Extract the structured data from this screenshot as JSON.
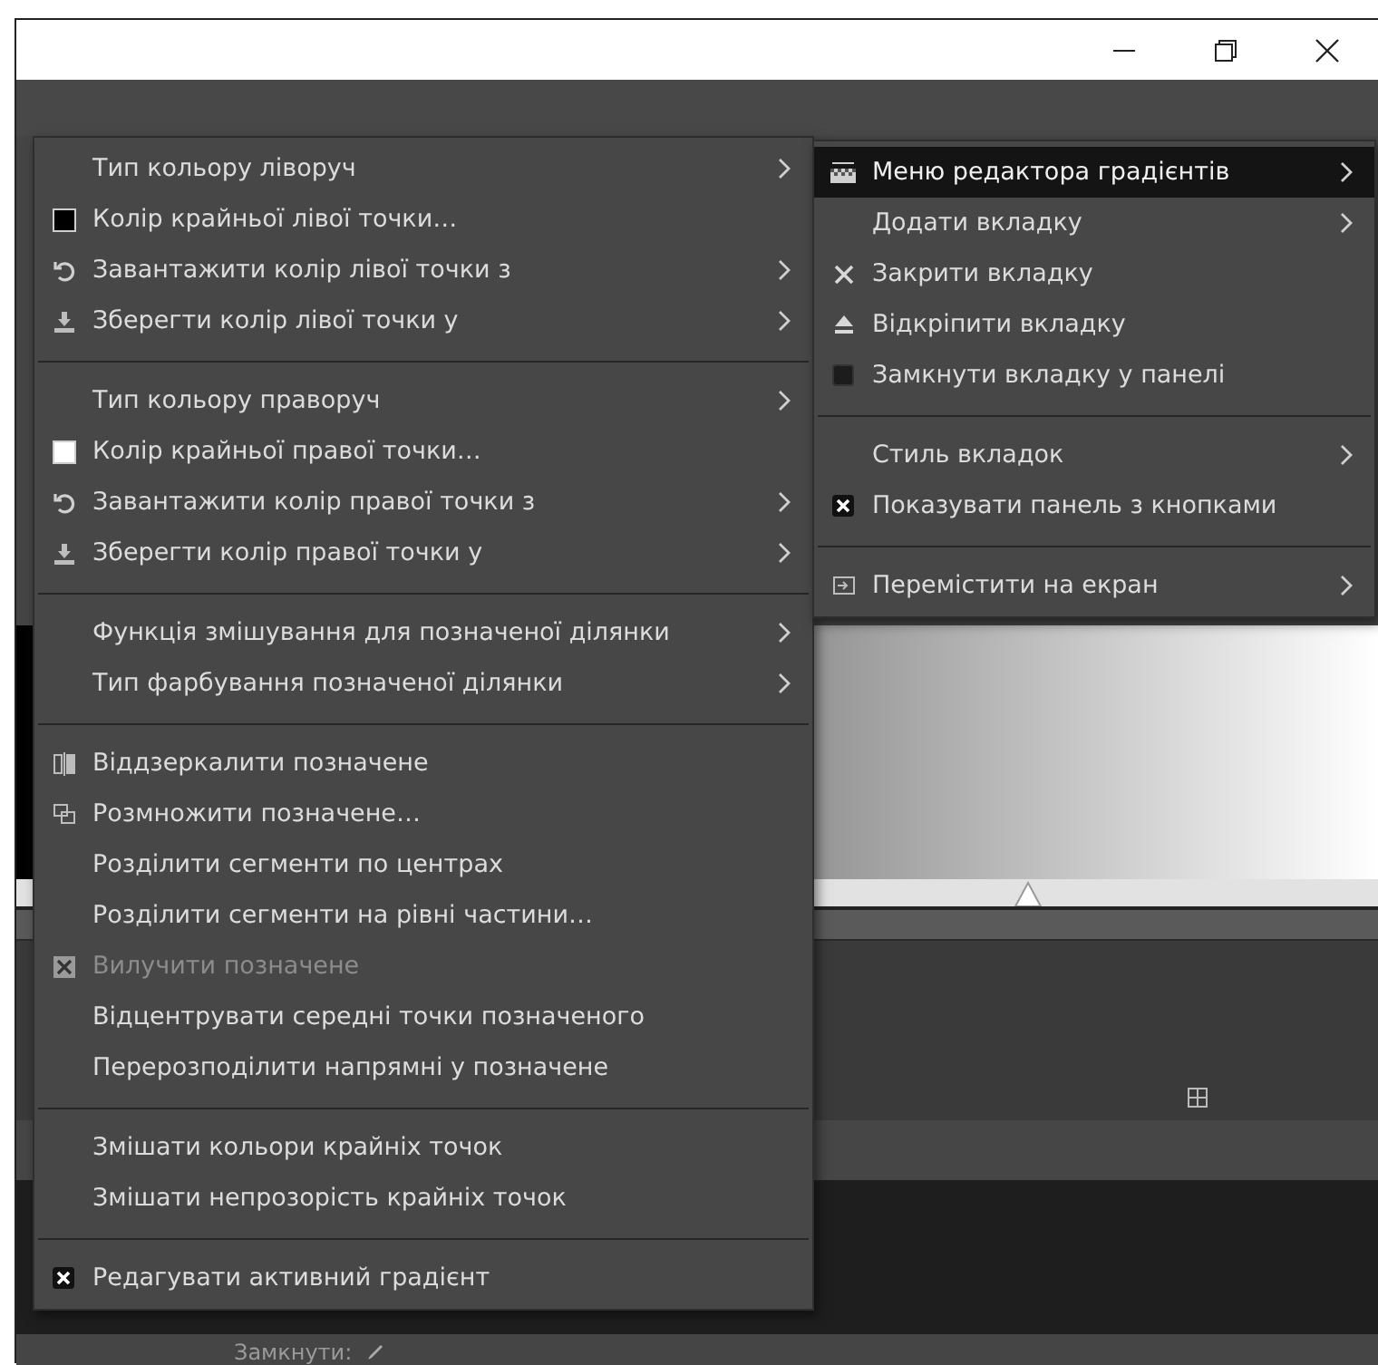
{
  "background": {
    "lock_label": "Замкнути:"
  },
  "main_menu": {
    "items": [
      {
        "kind": "plain",
        "label": "Тип кольору ліворуч",
        "submenu": true,
        "disabled": false
      },
      {
        "kind": "swatch",
        "color": "#000000",
        "label": "Колір крайньої лівої точки…",
        "submenu": false,
        "disabled": false
      },
      {
        "kind": "reload",
        "label": "Завантажити колір лівої точки з",
        "submenu": true,
        "disabled": false
      },
      {
        "kind": "save",
        "label": "Зберегти колір лівої точки у",
        "submenu": true,
        "disabled": false
      },
      {
        "kind": "separator"
      },
      {
        "kind": "plain",
        "label": "Тип кольору праворуч",
        "submenu": true,
        "disabled": false
      },
      {
        "kind": "swatch",
        "color": "#ffffff",
        "label": "Колір крайньої правої точки…",
        "submenu": false,
        "disabled": false
      },
      {
        "kind": "reload",
        "label": "Завантажити колір правої точки з",
        "submenu": true,
        "disabled": false
      },
      {
        "kind": "save",
        "label": "Зберегти колір правої точки у",
        "submenu": true,
        "disabled": false
      },
      {
        "kind": "separator"
      },
      {
        "kind": "plain",
        "label": "Функція змішування для позначеної ділянки",
        "submenu": true,
        "disabled": false
      },
      {
        "kind": "plain",
        "label": "Тип фарбування позначеної ділянки",
        "submenu": true,
        "disabled": false
      },
      {
        "kind": "separator"
      },
      {
        "kind": "flip",
        "label": "Віддзеркалити позначене",
        "submenu": false,
        "disabled": false
      },
      {
        "kind": "duplicate",
        "label": "Розмножити позначене…",
        "submenu": false,
        "disabled": false
      },
      {
        "kind": "plain",
        "label": "Розділити сегменти по центрах",
        "submenu": false,
        "disabled": false
      },
      {
        "kind": "plain",
        "label": "Розділити сегменти на рівні частини…",
        "submenu": false,
        "disabled": false
      },
      {
        "kind": "delete",
        "label": "Вилучити позначене",
        "submenu": false,
        "disabled": true
      },
      {
        "kind": "plain",
        "label": "Відцентрувати середні точки позначеного",
        "submenu": false,
        "disabled": false
      },
      {
        "kind": "plain",
        "label": "Перерозподілити напрямні у позначене",
        "submenu": false,
        "disabled": false
      },
      {
        "kind": "separator"
      },
      {
        "kind": "plain",
        "label": "Змішати кольори крайніх точок",
        "submenu": false,
        "disabled": false
      },
      {
        "kind": "plain",
        "label": "Змішати непрозорість крайніх точок",
        "submenu": false,
        "disabled": false
      },
      {
        "kind": "separator"
      },
      {
        "kind": "check",
        "checked": true,
        "label": "Редагувати активний градієнт",
        "submenu": false,
        "disabled": false
      }
    ]
  },
  "submenu": {
    "items": [
      {
        "kind": "gradient",
        "label": "Меню редактора градієнтів",
        "submenu": true,
        "selected": true
      },
      {
        "kind": "plain",
        "label": "Додати вкладку",
        "submenu": true,
        "selected": false
      },
      {
        "kind": "close",
        "label": "Закрити вкладку",
        "submenu": false,
        "selected": false
      },
      {
        "kind": "eject",
        "label": "Відкріпити вкладку",
        "submenu": false,
        "selected": false
      },
      {
        "kind": "check",
        "checked": false,
        "label": "Замкнути вкладку у панелі",
        "submenu": false,
        "selected": false
      },
      {
        "kind": "separator"
      },
      {
        "kind": "plain",
        "label": "Стиль вкладок",
        "submenu": true,
        "selected": false
      },
      {
        "kind": "check",
        "checked": true,
        "label": "Показувати панель з кнопками",
        "submenu": false,
        "selected": false
      },
      {
        "kind": "separator"
      },
      {
        "kind": "move",
        "label": "Перемістити на екран",
        "submenu": true,
        "selected": false
      }
    ]
  }
}
